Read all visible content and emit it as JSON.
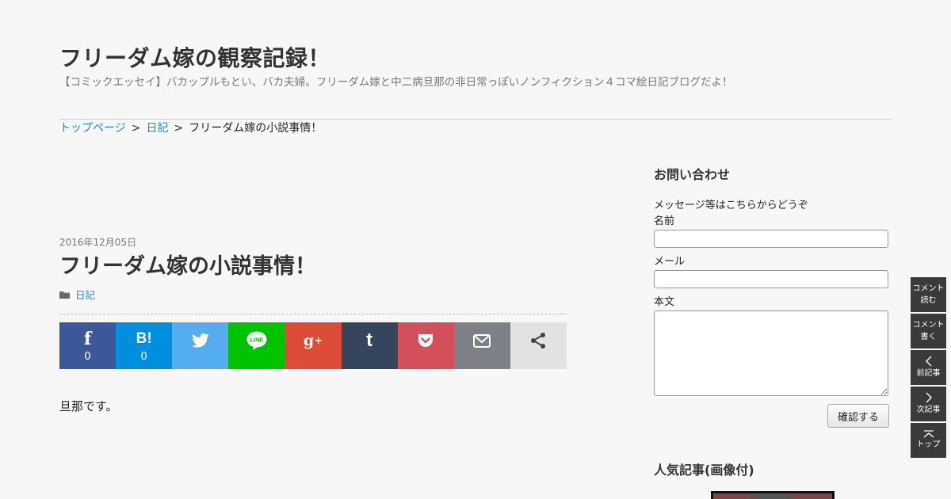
{
  "site": {
    "title": "フリーダム嫁の観察記録！",
    "description": "【コミックエッセイ】バカップルもとい、バカ夫婦。フリーダム嫁と中二病旦那の非日常っぽいノンフィクション４コマ絵日記ブログだよ！"
  },
  "breadcrumb": {
    "items": [
      "トップページ",
      "日記"
    ],
    "separator": ">",
    "current": "フリーダム嫁の小説事情！"
  },
  "post": {
    "date": "2016年12月05日",
    "title": "フリーダム嫁の小説事情！",
    "category": "日記",
    "body": "旦那です。"
  },
  "share": {
    "buttons": [
      {
        "name": "facebook",
        "icon": "f",
        "count": "0",
        "color": "#3b5998"
      },
      {
        "name": "hatena",
        "icon": "B!",
        "count": "0",
        "color": "#008fde"
      },
      {
        "name": "twitter",
        "icon": "twitter-bird",
        "count": "",
        "color": "#55acee"
      },
      {
        "name": "line",
        "icon": "LINE",
        "count": "",
        "color": "#00c300"
      },
      {
        "name": "googleplus",
        "icon": "g+",
        "count": "",
        "color": "#dd4b39"
      },
      {
        "name": "tumblr",
        "icon": "t",
        "count": "",
        "color": "#35465c"
      },
      {
        "name": "pocket",
        "icon": "pocket",
        "count": "",
        "color": "#d3505a"
      },
      {
        "name": "mail",
        "icon": "envelope",
        "count": "",
        "color": "#7f7f88"
      },
      {
        "name": "share",
        "icon": "share-nodes",
        "count": "",
        "color": "#e2e2e2"
      }
    ]
  },
  "contact": {
    "title": "お問い合わせ",
    "intro": "メッセージ等はこちらからどうぞ",
    "name_label": "名前",
    "mail_label": "メール",
    "body_label": "本文",
    "submit_label": "確認する"
  },
  "popular": {
    "title": "人気記事(画像付)"
  },
  "side_nav": {
    "comment_read": [
      "コメント",
      "読む"
    ],
    "comment_write": [
      "コメント",
      "書く"
    ],
    "prev": "前記事",
    "next": "次記事",
    "top": "トップ"
  }
}
